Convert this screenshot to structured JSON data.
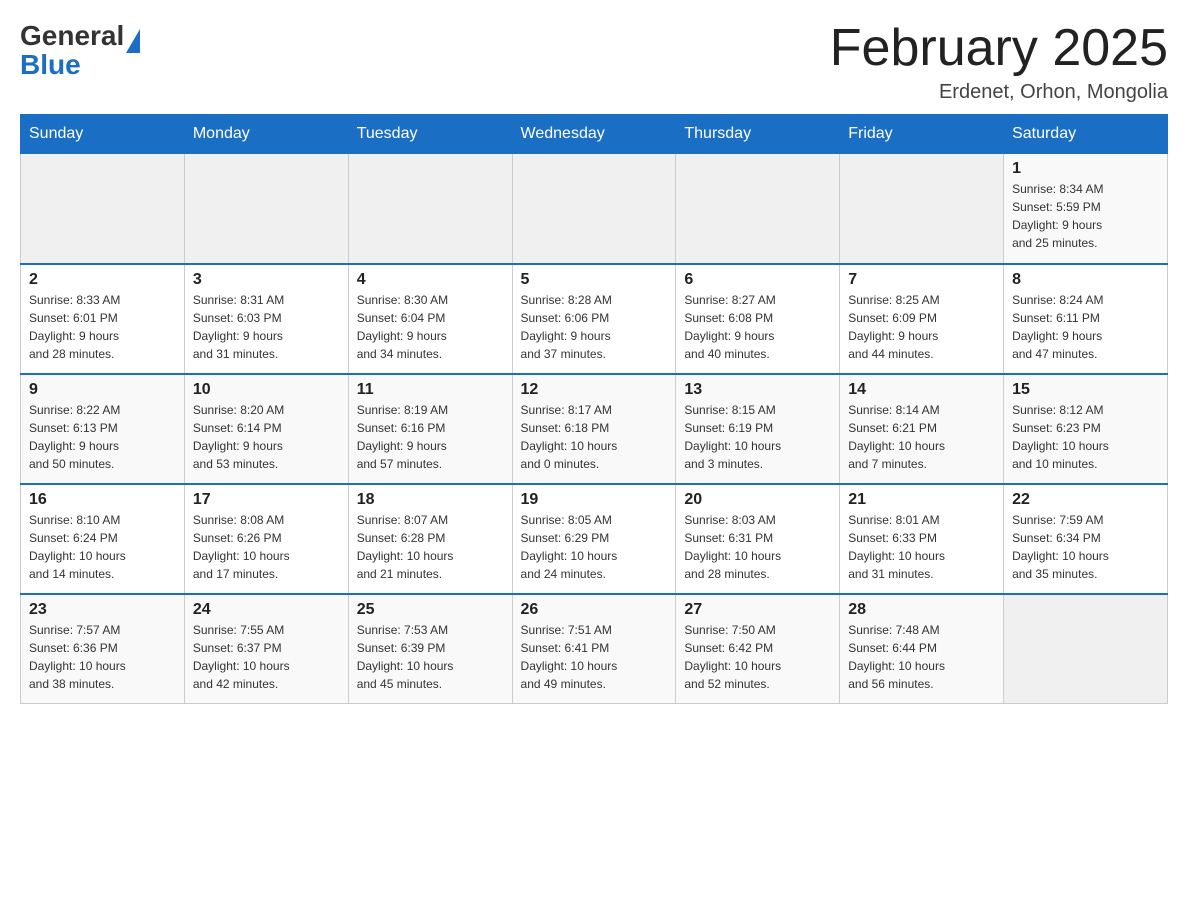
{
  "logo": {
    "general": "General",
    "blue": "Blue"
  },
  "title": "February 2025",
  "location": "Erdenet, Orhon, Mongolia",
  "days_of_week": [
    "Sunday",
    "Monday",
    "Tuesday",
    "Wednesday",
    "Thursday",
    "Friday",
    "Saturday"
  ],
  "weeks": [
    [
      {
        "day": "",
        "info": ""
      },
      {
        "day": "",
        "info": ""
      },
      {
        "day": "",
        "info": ""
      },
      {
        "day": "",
        "info": ""
      },
      {
        "day": "",
        "info": ""
      },
      {
        "day": "",
        "info": ""
      },
      {
        "day": "1",
        "info": "Sunrise: 8:34 AM\nSunset: 5:59 PM\nDaylight: 9 hours\nand 25 minutes."
      }
    ],
    [
      {
        "day": "2",
        "info": "Sunrise: 8:33 AM\nSunset: 6:01 PM\nDaylight: 9 hours\nand 28 minutes."
      },
      {
        "day": "3",
        "info": "Sunrise: 8:31 AM\nSunset: 6:03 PM\nDaylight: 9 hours\nand 31 minutes."
      },
      {
        "day": "4",
        "info": "Sunrise: 8:30 AM\nSunset: 6:04 PM\nDaylight: 9 hours\nand 34 minutes."
      },
      {
        "day": "5",
        "info": "Sunrise: 8:28 AM\nSunset: 6:06 PM\nDaylight: 9 hours\nand 37 minutes."
      },
      {
        "day": "6",
        "info": "Sunrise: 8:27 AM\nSunset: 6:08 PM\nDaylight: 9 hours\nand 40 minutes."
      },
      {
        "day": "7",
        "info": "Sunrise: 8:25 AM\nSunset: 6:09 PM\nDaylight: 9 hours\nand 44 minutes."
      },
      {
        "day": "8",
        "info": "Sunrise: 8:24 AM\nSunset: 6:11 PM\nDaylight: 9 hours\nand 47 minutes."
      }
    ],
    [
      {
        "day": "9",
        "info": "Sunrise: 8:22 AM\nSunset: 6:13 PM\nDaylight: 9 hours\nand 50 minutes."
      },
      {
        "day": "10",
        "info": "Sunrise: 8:20 AM\nSunset: 6:14 PM\nDaylight: 9 hours\nand 53 minutes."
      },
      {
        "day": "11",
        "info": "Sunrise: 8:19 AM\nSunset: 6:16 PM\nDaylight: 9 hours\nand 57 minutes."
      },
      {
        "day": "12",
        "info": "Sunrise: 8:17 AM\nSunset: 6:18 PM\nDaylight: 10 hours\nand 0 minutes."
      },
      {
        "day": "13",
        "info": "Sunrise: 8:15 AM\nSunset: 6:19 PM\nDaylight: 10 hours\nand 3 minutes."
      },
      {
        "day": "14",
        "info": "Sunrise: 8:14 AM\nSunset: 6:21 PM\nDaylight: 10 hours\nand 7 minutes."
      },
      {
        "day": "15",
        "info": "Sunrise: 8:12 AM\nSunset: 6:23 PM\nDaylight: 10 hours\nand 10 minutes."
      }
    ],
    [
      {
        "day": "16",
        "info": "Sunrise: 8:10 AM\nSunset: 6:24 PM\nDaylight: 10 hours\nand 14 minutes."
      },
      {
        "day": "17",
        "info": "Sunrise: 8:08 AM\nSunset: 6:26 PM\nDaylight: 10 hours\nand 17 minutes."
      },
      {
        "day": "18",
        "info": "Sunrise: 8:07 AM\nSunset: 6:28 PM\nDaylight: 10 hours\nand 21 minutes."
      },
      {
        "day": "19",
        "info": "Sunrise: 8:05 AM\nSunset: 6:29 PM\nDaylight: 10 hours\nand 24 minutes."
      },
      {
        "day": "20",
        "info": "Sunrise: 8:03 AM\nSunset: 6:31 PM\nDaylight: 10 hours\nand 28 minutes."
      },
      {
        "day": "21",
        "info": "Sunrise: 8:01 AM\nSunset: 6:33 PM\nDaylight: 10 hours\nand 31 minutes."
      },
      {
        "day": "22",
        "info": "Sunrise: 7:59 AM\nSunset: 6:34 PM\nDaylight: 10 hours\nand 35 minutes."
      }
    ],
    [
      {
        "day": "23",
        "info": "Sunrise: 7:57 AM\nSunset: 6:36 PM\nDaylight: 10 hours\nand 38 minutes."
      },
      {
        "day": "24",
        "info": "Sunrise: 7:55 AM\nSunset: 6:37 PM\nDaylight: 10 hours\nand 42 minutes."
      },
      {
        "day": "25",
        "info": "Sunrise: 7:53 AM\nSunset: 6:39 PM\nDaylight: 10 hours\nand 45 minutes."
      },
      {
        "day": "26",
        "info": "Sunrise: 7:51 AM\nSunset: 6:41 PM\nDaylight: 10 hours\nand 49 minutes."
      },
      {
        "day": "27",
        "info": "Sunrise: 7:50 AM\nSunset: 6:42 PM\nDaylight: 10 hours\nand 52 minutes."
      },
      {
        "day": "28",
        "info": "Sunrise: 7:48 AM\nSunset: 6:44 PM\nDaylight: 10 hours\nand 56 minutes."
      },
      {
        "day": "",
        "info": ""
      }
    ]
  ]
}
